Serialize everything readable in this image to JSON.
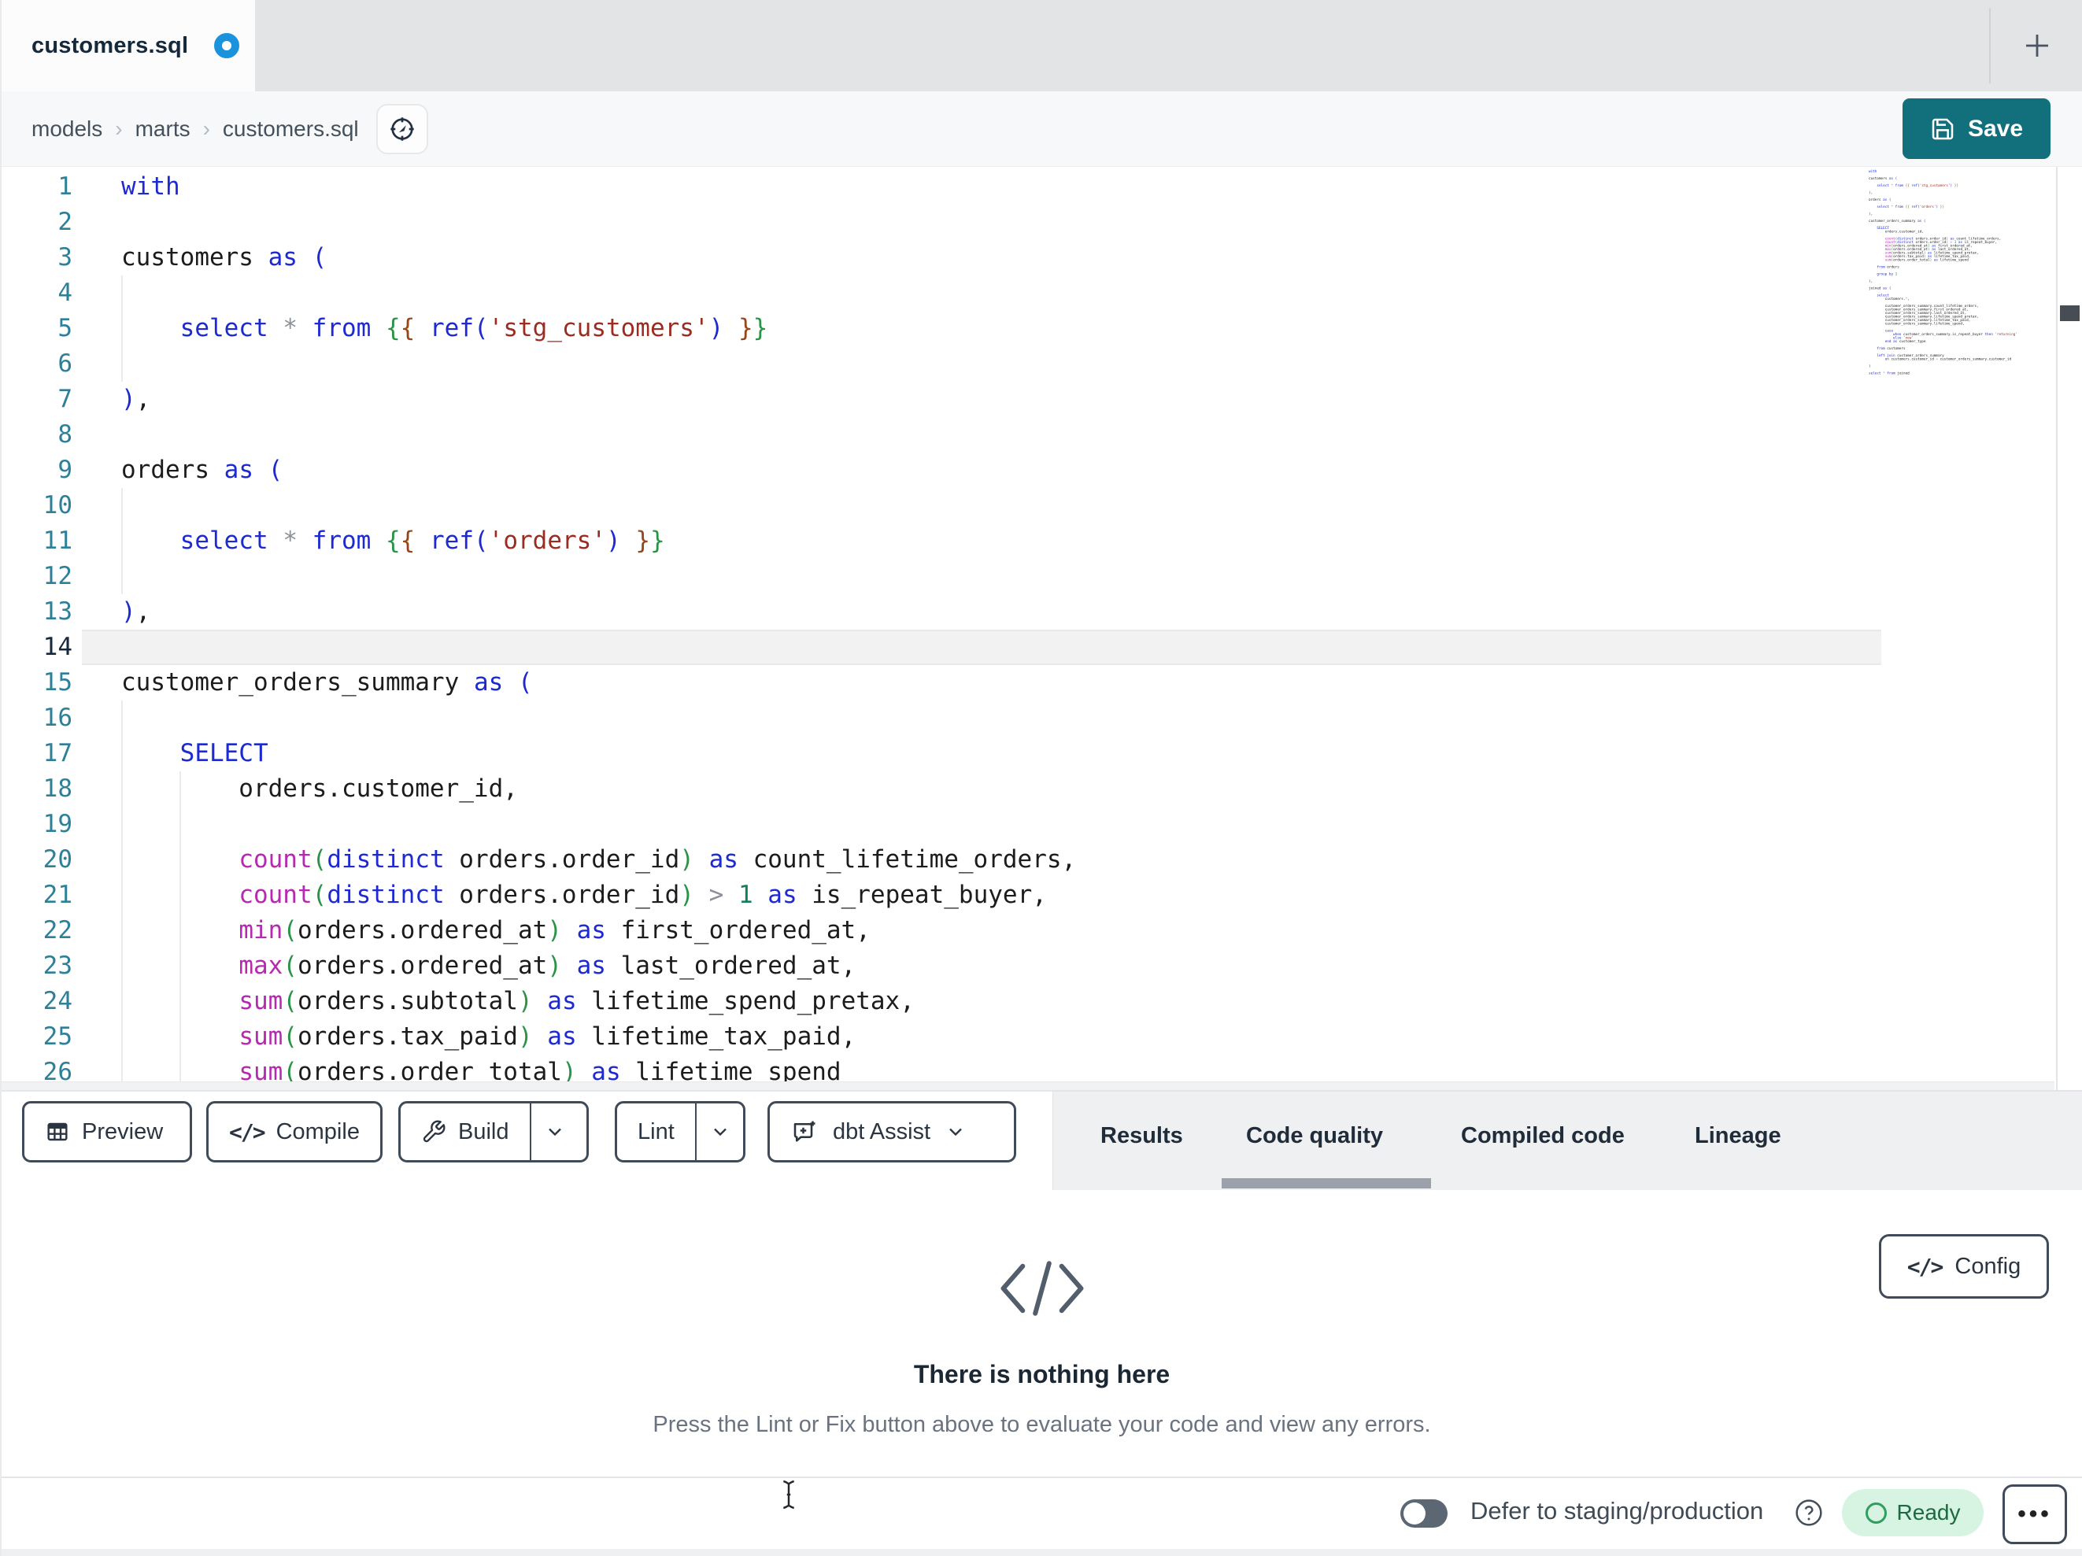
{
  "tab_bar": {
    "active_tab_title": "customers.sql"
  },
  "breadcrumb": {
    "items": [
      "models",
      "marts",
      "customers.sql"
    ],
    "separator": "›"
  },
  "save": {
    "label": "Save"
  },
  "colors": {
    "accent_teal": "#11707c",
    "unsaved_dot_blue": "#1a93dc",
    "ready_green_bg": "#d7f4e2",
    "keyword_blue": "#1d2ad1",
    "function_magenta": "#b52ab0",
    "string_red": "#9b2c21",
    "number_green": "#12805f",
    "bracket_green": "#2b9348",
    "jinja_brown": "#97461a",
    "line_number_teal": "#2e8098"
  },
  "editor": {
    "visible_lines": 26,
    "active_line": 14,
    "lines": [
      [
        [
          "kw",
          "with"
        ]
      ],
      [],
      [
        [
          "plain",
          "customers "
        ],
        [
          "kw",
          "as"
        ],
        [
          "plain",
          " "
        ],
        [
          "bb",
          "("
        ]
      ],
      [],
      [
        [
          "plain",
          "    "
        ],
        [
          "kw",
          "select"
        ],
        [
          "plain",
          " "
        ],
        [
          "op",
          "*"
        ],
        [
          "plain",
          " "
        ],
        [
          "kw",
          "from"
        ],
        [
          "plain",
          " "
        ],
        [
          "jg",
          "{"
        ],
        [
          "jb",
          "{"
        ],
        [
          "plain",
          " "
        ],
        [
          "kw",
          "ref"
        ],
        [
          "bb",
          "("
        ],
        [
          "str",
          "'stg_customers'"
        ],
        [
          "bb",
          ")"
        ],
        [
          "plain",
          " "
        ],
        [
          "jb",
          "}"
        ],
        [
          "jg",
          "}"
        ]
      ],
      [],
      [
        [
          "bb",
          ")"
        ],
        [
          "plain",
          ","
        ]
      ],
      [],
      [
        [
          "plain",
          "orders "
        ],
        [
          "kw",
          "as"
        ],
        [
          "plain",
          " "
        ],
        [
          "bb",
          "("
        ]
      ],
      [],
      [
        [
          "plain",
          "    "
        ],
        [
          "kw",
          "select"
        ],
        [
          "plain",
          " "
        ],
        [
          "op",
          "*"
        ],
        [
          "plain",
          " "
        ],
        [
          "kw",
          "from"
        ],
        [
          "plain",
          " "
        ],
        [
          "jg",
          "{"
        ],
        [
          "jb",
          "{"
        ],
        [
          "plain",
          " "
        ],
        [
          "kw",
          "ref"
        ],
        [
          "bb",
          "("
        ],
        [
          "str",
          "'orders'"
        ],
        [
          "bb",
          ")"
        ],
        [
          "plain",
          " "
        ],
        [
          "jb",
          "}"
        ],
        [
          "jg",
          "}"
        ]
      ],
      [],
      [
        [
          "bb",
          ")"
        ],
        [
          "plain",
          ","
        ]
      ],
      [],
      [
        [
          "plain",
          "customer_orders_summary "
        ],
        [
          "kw",
          "as"
        ],
        [
          "plain",
          " "
        ],
        [
          "bb",
          "("
        ]
      ],
      [],
      [
        [
          "plain",
          "    "
        ],
        [
          "kw",
          "SELECT"
        ]
      ],
      [
        [
          "plain",
          "        orders.customer_id,"
        ]
      ],
      [],
      [
        [
          "plain",
          "        "
        ],
        [
          "fn",
          "count"
        ],
        [
          "brg",
          "("
        ],
        [
          "kw",
          "distinct"
        ],
        [
          "plain",
          " orders.order_id"
        ],
        [
          "brg",
          ")"
        ],
        [
          "plain",
          " "
        ],
        [
          "kw",
          "as"
        ],
        [
          "plain",
          " count_lifetime_orders,"
        ]
      ],
      [
        [
          "plain",
          "        "
        ],
        [
          "fn",
          "count"
        ],
        [
          "brg",
          "("
        ],
        [
          "kw",
          "distinct"
        ],
        [
          "plain",
          " orders.order_id"
        ],
        [
          "brg",
          ")"
        ],
        [
          "plain",
          " "
        ],
        [
          "op",
          ">"
        ],
        [
          "plain",
          " "
        ],
        [
          "num",
          "1"
        ],
        [
          "plain",
          " "
        ],
        [
          "kw",
          "as"
        ],
        [
          "plain",
          " is_repeat_buyer,"
        ]
      ],
      [
        [
          "plain",
          "        "
        ],
        [
          "fn",
          "min"
        ],
        [
          "brg",
          "("
        ],
        [
          "plain",
          "orders.ordered_at"
        ],
        [
          "brg",
          ")"
        ],
        [
          "plain",
          " "
        ],
        [
          "kw",
          "as"
        ],
        [
          "plain",
          " first_ordered_at,"
        ]
      ],
      [
        [
          "plain",
          "        "
        ],
        [
          "fn",
          "max"
        ],
        [
          "brg",
          "("
        ],
        [
          "plain",
          "orders.ordered_at"
        ],
        [
          "brg",
          ")"
        ],
        [
          "plain",
          " "
        ],
        [
          "kw",
          "as"
        ],
        [
          "plain",
          " last_ordered_at,"
        ]
      ],
      [
        [
          "plain",
          "        "
        ],
        [
          "fn",
          "sum"
        ],
        [
          "brg",
          "("
        ],
        [
          "plain",
          "orders.subtotal"
        ],
        [
          "brg",
          ")"
        ],
        [
          "plain",
          " "
        ],
        [
          "kw",
          "as"
        ],
        [
          "plain",
          " lifetime_spend_pretax,"
        ]
      ],
      [
        [
          "plain",
          "        "
        ],
        [
          "fn",
          "sum"
        ],
        [
          "brg",
          "("
        ],
        [
          "plain",
          "orders.tax_paid"
        ],
        [
          "brg",
          ")"
        ],
        [
          "plain",
          " "
        ],
        [
          "kw",
          "as"
        ],
        [
          "plain",
          " lifetime_tax_paid,"
        ]
      ],
      [
        [
          "plain",
          "        "
        ],
        [
          "fn",
          "sum"
        ],
        [
          "brg",
          "("
        ],
        [
          "plain",
          "orders.order_total"
        ],
        [
          "brg",
          ")"
        ],
        [
          "plain",
          " "
        ],
        [
          "kw",
          "as"
        ],
        [
          "plain",
          " lifetime_spend"
        ]
      ],
      [],
      [
        [
          "plain",
          "    "
        ],
        [
          "kw",
          "from"
        ],
        [
          "plain",
          " orders"
        ]
      ],
      [],
      [
        [
          "plain",
          "    "
        ],
        [
          "kw",
          "group"
        ],
        [
          "plain",
          " "
        ],
        [
          "kw",
          "by"
        ],
        [
          "plain",
          " "
        ],
        [
          "num",
          "1"
        ]
      ],
      [],
      [
        [
          "bb",
          ")"
        ],
        [
          "plain",
          ","
        ]
      ],
      [],
      [
        [
          "plain",
          "joined "
        ],
        [
          "kw",
          "as"
        ],
        [
          "plain",
          " "
        ],
        [
          "bb",
          "("
        ]
      ],
      [],
      [
        [
          "plain",
          "    "
        ],
        [
          "kw",
          "select"
        ]
      ],
      [
        [
          "plain",
          "        customers."
        ],
        [
          "op",
          "*"
        ],
        [
          "plain",
          ","
        ]
      ],
      [],
      [
        [
          "plain",
          "        customer_orders_summary.count_lifetime_orders,"
        ]
      ],
      [
        [
          "plain",
          "        customer_orders_summary.first_ordered_at,"
        ]
      ],
      [
        [
          "plain",
          "        customer_orders_summary.last_ordered_at,"
        ]
      ],
      [
        [
          "plain",
          "        customer_orders_summary.lifetime_spend_pretax,"
        ]
      ],
      [
        [
          "plain",
          "        customer_orders_summary.lifetime_tax_paid,"
        ]
      ],
      [
        [
          "plain",
          "        customer_orders_summary.lifetime_spend,"
        ]
      ],
      [],
      [
        [
          "plain",
          "        "
        ],
        [
          "kw",
          "case"
        ]
      ],
      [
        [
          "plain",
          "            "
        ],
        [
          "kw",
          "when"
        ],
        [
          "plain",
          " customer_orders_summary.is_repeat_buyer "
        ],
        [
          "kw",
          "then"
        ],
        [
          "plain",
          " "
        ],
        [
          "str",
          "'returning'"
        ]
      ],
      [
        [
          "plain",
          "            "
        ],
        [
          "kw",
          "else"
        ],
        [
          "plain",
          " "
        ],
        [
          "str",
          "'new'"
        ]
      ],
      [
        [
          "plain",
          "        "
        ],
        [
          "kw",
          "end"
        ],
        [
          "plain",
          " "
        ],
        [
          "kw",
          "as"
        ],
        [
          "plain",
          " customer_type"
        ]
      ],
      [],
      [
        [
          "plain",
          "    "
        ],
        [
          "kw",
          "from"
        ],
        [
          "plain",
          " customers"
        ]
      ],
      [],
      [
        [
          "plain",
          "    "
        ],
        [
          "kw",
          "left"
        ],
        [
          "plain",
          " "
        ],
        [
          "kw",
          "join"
        ],
        [
          "plain",
          " customer_orders_summary"
        ]
      ],
      [
        [
          "plain",
          "        "
        ],
        [
          "kw",
          "on"
        ],
        [
          "plain",
          " customers.customer_id "
        ],
        [
          "op",
          "="
        ],
        [
          "plain",
          " customer_orders_summary.customer_id"
        ]
      ],
      [],
      [
        [
          "bb",
          ")"
        ]
      ],
      [],
      [
        [
          "kw",
          "select"
        ],
        [
          "plain",
          " "
        ],
        [
          "op",
          "*"
        ],
        [
          "plain",
          " "
        ],
        [
          "kw",
          "from"
        ],
        [
          "plain",
          " joined"
        ]
      ]
    ]
  },
  "toolbar": {
    "buttons": [
      {
        "label": "Preview",
        "icon": "table-icon"
      },
      {
        "label": "Compile",
        "icon": "code-icon"
      },
      {
        "label": "Build",
        "icon": "wrench-icon",
        "split": true
      },
      {
        "label": "Lint",
        "split": true
      },
      {
        "label": "dbt Assist",
        "icon": "assist-chat-icon",
        "chevron": true
      }
    ]
  },
  "result_tabs": {
    "items": [
      "Results",
      "Code quality",
      "Compiled code",
      "Lineage"
    ],
    "active": "Code quality"
  },
  "panel": {
    "config_label": "Config",
    "empty_title": "There is nothing here",
    "empty_subtitle": "Press the Lint or Fix button above to evaluate your code and view any errors."
  },
  "statusbar": {
    "defer_label": "Defer to staging/production",
    "ready_label": "Ready"
  }
}
